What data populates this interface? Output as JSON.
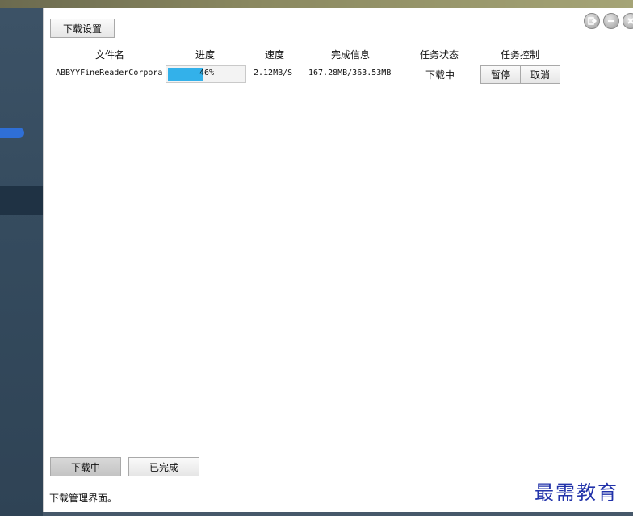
{
  "toolbar": {
    "settings_label": "下载设置"
  },
  "window_controls": {
    "exit_icon": "exit-icon",
    "minimize_icon": "minimize-icon",
    "close_icon": "close-icon"
  },
  "table": {
    "columns": [
      "文件名",
      "进度",
      "速度",
      "完成信息",
      "任务状态",
      "任务控制"
    ],
    "rows": [
      {
        "file_name": "ABBYYFineReaderCorpora",
        "progress_percent": 46,
        "progress_label": "46%",
        "speed": "2.12MB/S",
        "completion_info": "167.28MB/363.53MB",
        "status": "下载中",
        "pause_label": "暂停",
        "cancel_label": "取消"
      }
    ]
  },
  "tabs": {
    "downloading": "下载中",
    "completed": "已完成"
  },
  "caption": "下载管理界面。",
  "watermark": "最需教育",
  "colors": {
    "progress_fill": "#33b1ea",
    "watermark": "#2233aa"
  }
}
